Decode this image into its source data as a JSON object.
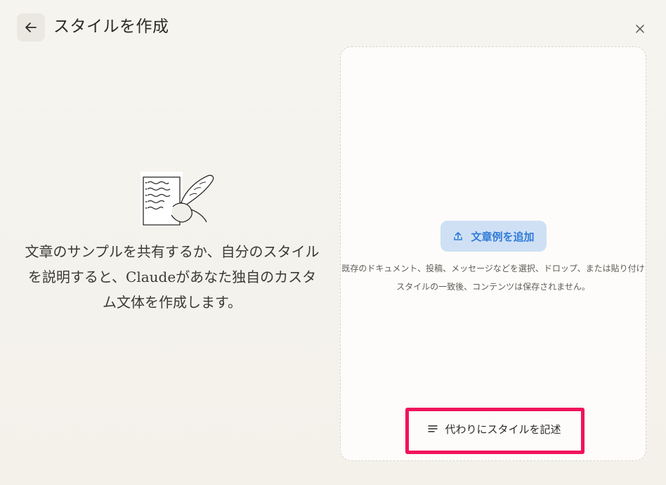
{
  "header": {
    "title": "スタイルを作成"
  },
  "intro": {
    "description": "文章のサンプルを共有するか、自分のスタイルを説明すると、Claudeがあなた独自のカスタム文体を作成します。"
  },
  "upload": {
    "button_label": "文章例を追加",
    "hint_line1": "既存のドキュメント、投稿、メッセージなどを選択、ドロップ、または貼り付け",
    "hint_line2": "スタイルの一致後、コンテンツは保存されません。"
  },
  "alternative": {
    "button_label": "代わりにスタイルを記述"
  },
  "colors": {
    "accent_blue": "#2f7bd8",
    "button_blue_bg": "#cfe0f5",
    "highlight": "#f0135b",
    "background": "#f6f4ef"
  },
  "icons": {
    "back": "arrow-left-icon",
    "close": "close-icon",
    "upload": "upload-icon",
    "describe": "text-lines-icon",
    "illustration": "quill-writing-illustration"
  }
}
